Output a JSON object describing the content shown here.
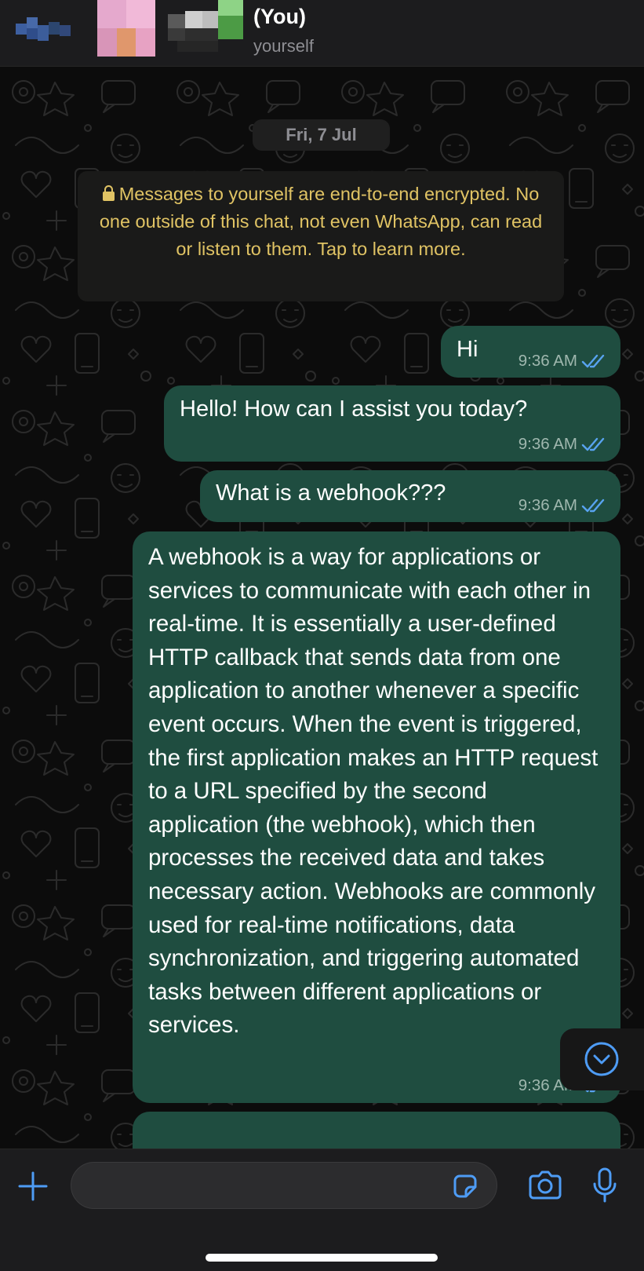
{
  "header": {
    "title": "(You)",
    "subtitle": "yourself"
  },
  "chat": {
    "date": "Fri, 7 Jul",
    "system_note": "Messages to yourself are end-to-end encrypted. No one outside of this chat, not even WhatsApp, can read or listen to them. Tap to learn more.",
    "messages": [
      {
        "text": "Hi",
        "time": "9:36 AM",
        "status": "read"
      },
      {
        "text": "Hello! How can I assist you today?",
        "time": "9:36 AM",
        "status": "read"
      },
      {
        "text": "What is a webhook???",
        "time": "9:36 AM",
        "status": "read"
      },
      {
        "text": "A webhook is a way for applications or services to communicate with each other in real-time. It is essentially a user-defined HTTP callback that sends data from one application to another whenever a specific event occurs. When the event is triggered, the first application makes an HTTP request to a URL specified by the second application (the webhook), which then processes the received data and takes necessary action. Webhooks are commonly used for real-time notifications, data synchronization, and triggering automated tasks between different applications or services.",
        "time": "9:36 AM",
        "status": "read"
      }
    ]
  },
  "input": {
    "placeholder": ""
  },
  "icons": {
    "back": "blurred-back-icon",
    "avatar": "avatar",
    "plus": "plus-icon",
    "sticker": "sticker-icon",
    "camera": "camera-icon",
    "mic": "microphone-icon",
    "scroll": "chevron-down-circle-icon",
    "ticks": "double-check-icon",
    "lock": "lock-icon"
  },
  "colors": {
    "bubble": "#1f4d40",
    "accent": "#4e9cf5",
    "note_text": "#e0c364",
    "read_ticks": "#58a3f0"
  }
}
